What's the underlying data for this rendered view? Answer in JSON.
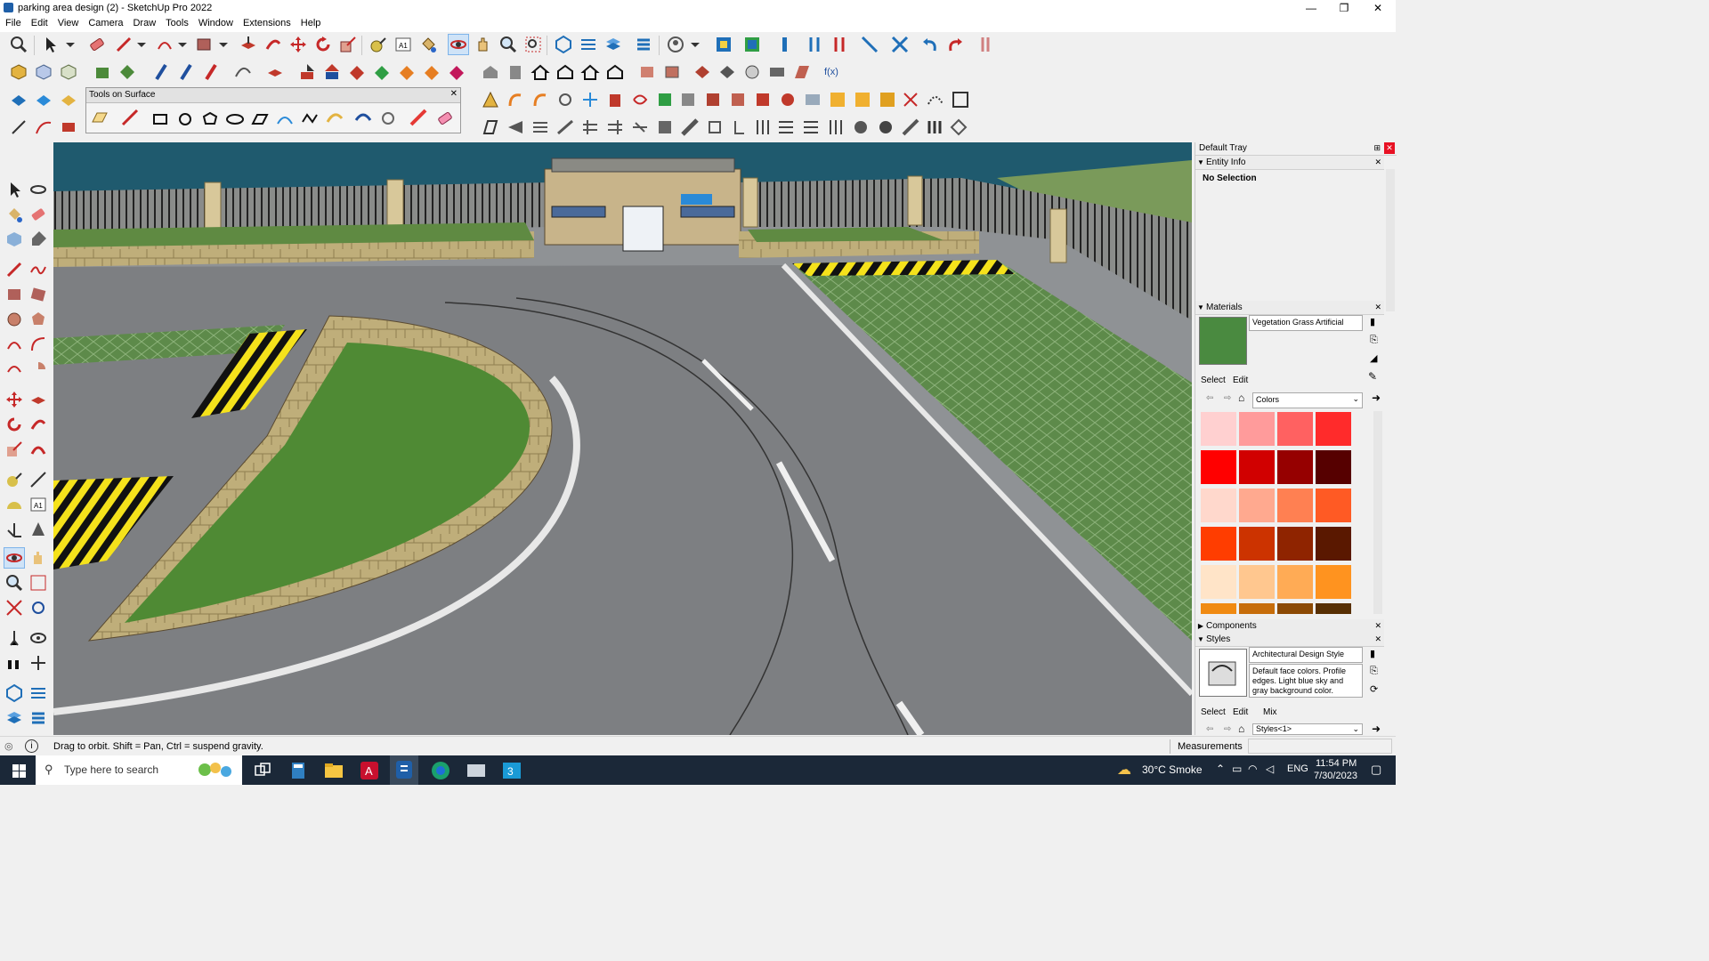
{
  "window": {
    "title": "parking area design (2) - SketchUp Pro 2022",
    "controls": {
      "minimize": "—",
      "restore": "❐",
      "close": "✕"
    }
  },
  "menu": [
    "File",
    "Edit",
    "View",
    "Camera",
    "Draw",
    "Tools",
    "Window",
    "Extensions",
    "Help"
  ],
  "floating_toolbar": {
    "title": "Tools on Surface",
    "close": "✕"
  },
  "tray": {
    "title": "Default Tray",
    "entity_info": {
      "header": "Entity Info",
      "value": "No Selection"
    },
    "materials": {
      "header": "Materials",
      "name": "Vegetation Grass Artificial",
      "tab_select": "Select",
      "tab_edit": "Edit",
      "library": "Colors",
      "swatches": [
        "#ffd0d0",
        "#ff9b9b",
        "#ff6161",
        "#ff2b2b",
        "#ff0000",
        "#d10000",
        "#960000",
        "#560000",
        "#ffd8cc",
        "#ffa98f",
        "#ff8052",
        "#ff5a24",
        "#ff3d00",
        "#cc3300",
        "#8f2400",
        "#5a1800",
        "#ffe4c8",
        "#ffc78f",
        "#ffab55",
        "#ff931f",
        "#f08a12",
        "#c76d0b",
        "#8c4a05",
        "#583004"
      ]
    },
    "components": {
      "header": "Components"
    },
    "styles": {
      "header": "Styles",
      "name": "Architectural Design Style",
      "description": "Default face colors. Profile edges. Light blue sky and gray background color.",
      "tab_select": "Select",
      "tab_edit": "Edit",
      "tab_mix": "Mix",
      "library": "Styles<1>"
    }
  },
  "status": {
    "hint": "Drag to orbit. Shift = Pan, Ctrl = suspend gravity.",
    "measurements_label": "Measurements"
  },
  "taskbar": {
    "search_placeholder": "Type here to search",
    "weather": "30°C  Smoke",
    "language": "ENG",
    "time": "11:54 PM",
    "date": "7/30/2023"
  },
  "colors": {
    "accent": "#0078d7",
    "taskbar_bg": "#1b2838",
    "asphalt": "#7d7f82",
    "grass": "#4f8a34",
    "sky_water": "#1f5a6e"
  }
}
